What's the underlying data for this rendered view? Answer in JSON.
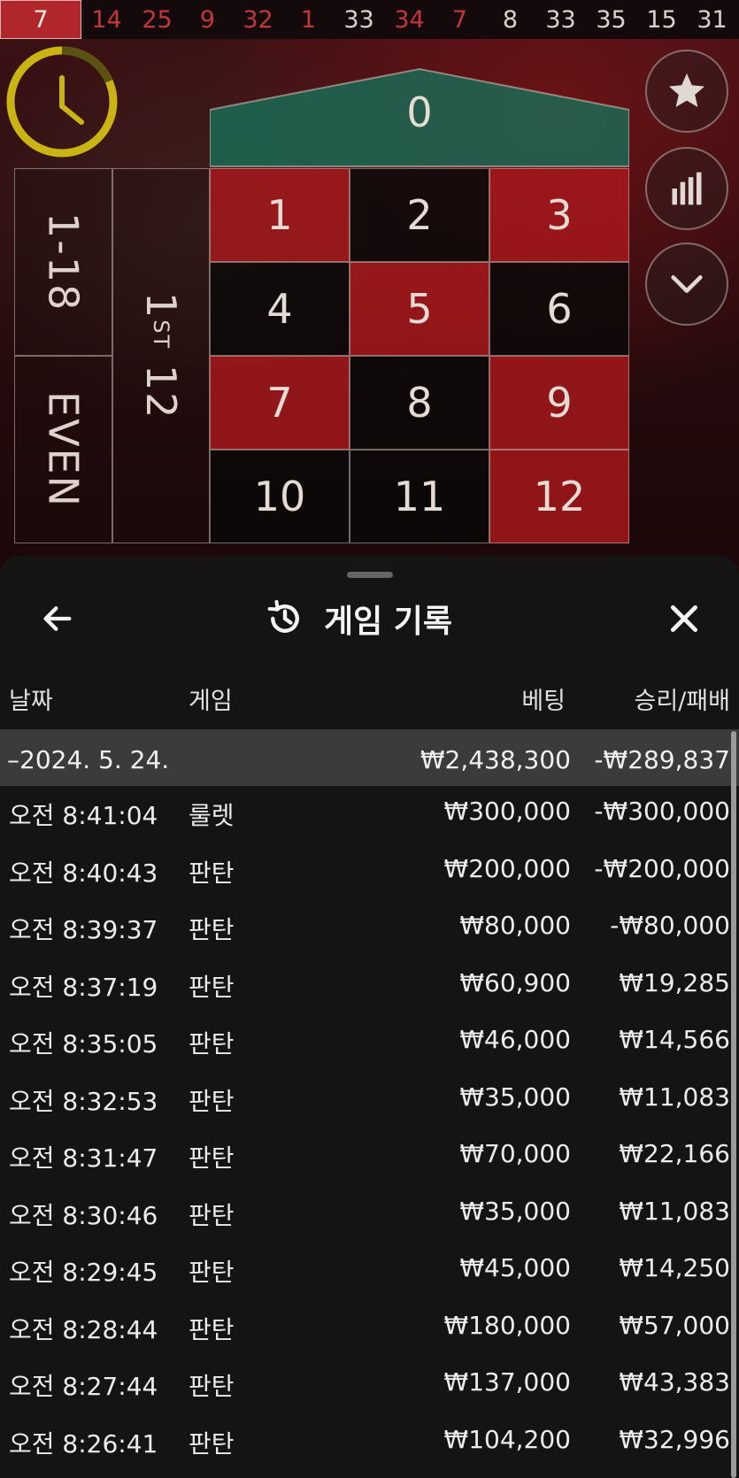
{
  "results": [
    {
      "n": "7",
      "c": "red"
    },
    {
      "n": "14",
      "c": "red"
    },
    {
      "n": "25",
      "c": "red"
    },
    {
      "n": "9",
      "c": "red"
    },
    {
      "n": "32",
      "c": "red"
    },
    {
      "n": "1",
      "c": "red"
    },
    {
      "n": "33",
      "c": "black"
    },
    {
      "n": "34",
      "c": "red"
    },
    {
      "n": "7",
      "c": "red"
    },
    {
      "n": "8",
      "c": "black"
    },
    {
      "n": "33",
      "c": "black"
    },
    {
      "n": "35",
      "c": "black"
    },
    {
      "n": "15",
      "c": "black"
    },
    {
      "n": "31",
      "c": "black"
    }
  ],
  "table": {
    "zero": "0",
    "numbers": [
      "1",
      "2",
      "3",
      "4",
      "5",
      "6",
      "7",
      "8",
      "9",
      "10",
      "11",
      "12"
    ],
    "low": "1-18",
    "even": "EVEN",
    "dozen_num": "1",
    "dozen_sup": "ST",
    "dozen_val": "12"
  },
  "history": {
    "title": "게임 기록",
    "columns": {
      "date": "날짜",
      "game": "게임",
      "bet": "베팅",
      "win": "승리/패배"
    },
    "day": {
      "date": "–2024. 5. 24.",
      "bet": "₩2,438,300",
      "win": "-₩289,837"
    },
    "rows": [
      {
        "time": "오전 8:41:04",
        "game": "룰렛",
        "bet": "₩300,000",
        "win": "-₩300,000"
      },
      {
        "time": "오전 8:40:43",
        "game": "판탄",
        "bet": "₩200,000",
        "win": "-₩200,000"
      },
      {
        "time": "오전 8:39:37",
        "game": "판탄",
        "bet": "₩80,000",
        "win": "-₩80,000"
      },
      {
        "time": "오전 8:37:19",
        "game": "판탄",
        "bet": "₩60,900",
        "win": "₩19,285"
      },
      {
        "time": "오전 8:35:05",
        "game": "판탄",
        "bet": "₩46,000",
        "win": "₩14,566"
      },
      {
        "time": "오전 8:32:53",
        "game": "판탄",
        "bet": "₩35,000",
        "win": "₩11,083"
      },
      {
        "time": "오전 8:31:47",
        "game": "판탄",
        "bet": "₩70,000",
        "win": "₩22,166"
      },
      {
        "time": "오전 8:30:46",
        "game": "판탄",
        "bet": "₩35,000",
        "win": "₩11,083"
      },
      {
        "time": "오전 8:29:45",
        "game": "판탄",
        "bet": "₩45,000",
        "win": "₩14,250"
      },
      {
        "time": "오전 8:28:44",
        "game": "판탄",
        "bet": "₩180,000",
        "win": "₩57,000"
      },
      {
        "time": "오전 8:27:44",
        "game": "판탄",
        "bet": "₩137,000",
        "win": "₩43,383"
      },
      {
        "time": "오전 8:26:41",
        "game": "판탄",
        "bet": "₩104,200",
        "win": "₩32,996"
      }
    ]
  },
  "icons": {
    "favorite": "star-icon",
    "stats": "bar-chart-icon",
    "collapse": "chevron-down-icon",
    "timer": "timer-icon",
    "back": "back-arrow-icon",
    "history": "history-icon",
    "close": "close-icon"
  },
  "colors": {
    "red": "#a8181c",
    "black": "#0a0808",
    "zero_green": "#1f6b57",
    "timer": "#c9b413"
  }
}
